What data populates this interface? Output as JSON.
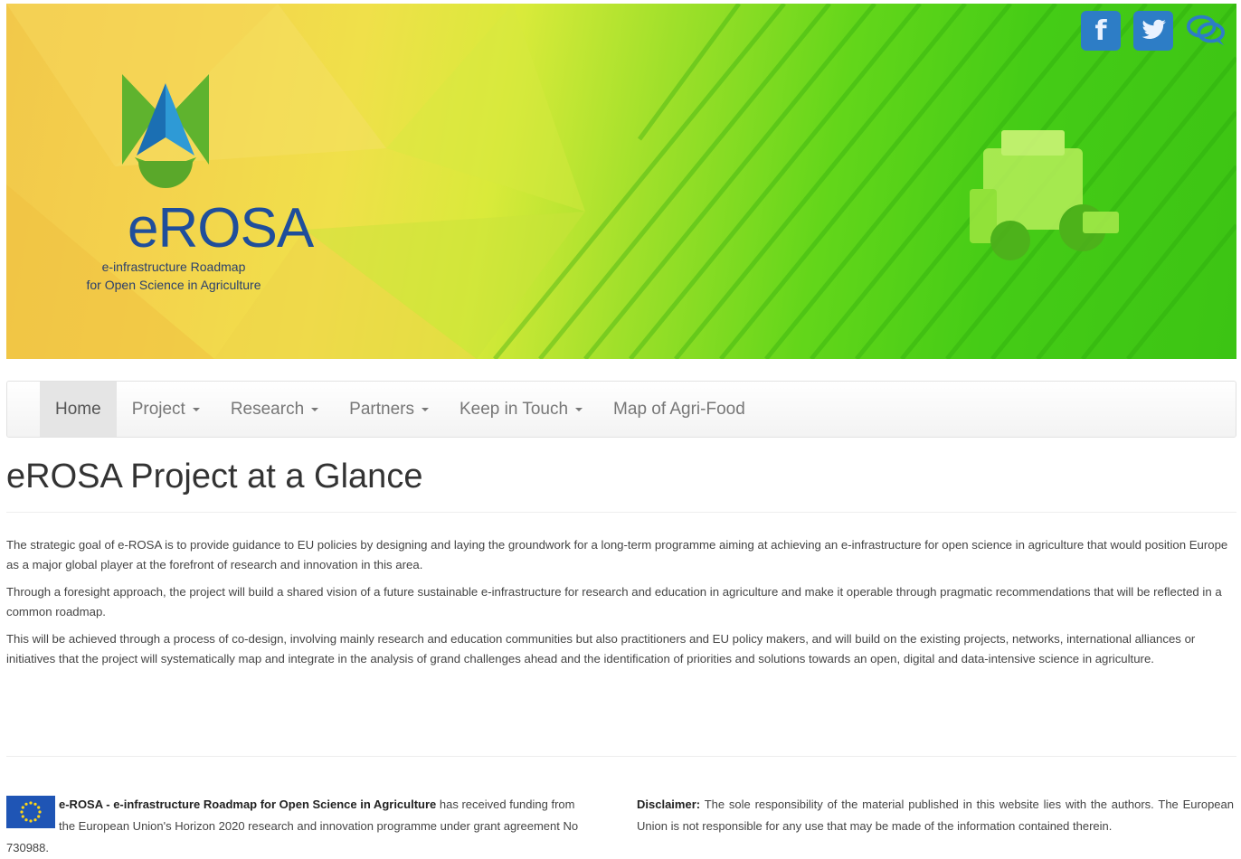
{
  "banner": {
    "logo_title": "eROSA",
    "logo_subtitle_line1": "e-infrastructure Roadmap",
    "logo_subtitle_line2": "for Open Science in Agriculture",
    "social": [
      {
        "icon": "facebook-icon",
        "glyph": "f"
      },
      {
        "icon": "twitter-icon",
        "glyph": "t"
      },
      {
        "icon": "chat-icon",
        "glyph": ""
      }
    ]
  },
  "nav": {
    "items": [
      {
        "label": "Home",
        "active": true,
        "dropdown": false
      },
      {
        "label": "Project",
        "active": false,
        "dropdown": true
      },
      {
        "label": "Research",
        "active": false,
        "dropdown": true
      },
      {
        "label": "Partners",
        "active": false,
        "dropdown": true
      },
      {
        "label": "Keep in Touch",
        "active": false,
        "dropdown": true
      },
      {
        "label": "Map of Agri-Food",
        "active": false,
        "dropdown": false
      }
    ]
  },
  "main": {
    "title": "eROSA Project at a Glance",
    "paragraphs": [
      "The strategic goal of e-ROSA is to provide guidance to EU policies by designing and laying the groundwork for a long-term programme aiming at achieving an e-infrastructure for open science in agriculture that would position Europe as a major global player at the forefront of research and innovation in this area.",
      "Through a foresight approach, the project will build a shared vision of a future sustainable e-infrastructure for research and education in agriculture and make it operable through pragmatic recommendations that will be reflected in a common roadmap.",
      "This will be achieved through a process of co-design, involving mainly research and education communities but also practitioners and EU policy makers, and will build on the existing projects, networks, international alliances or initiatives that the project will systematically map and integrate in the analysis of grand challenges ahead and the identification of priorities and solutions towards an open, digital and data-intensive science in agriculture."
    ]
  },
  "footer": {
    "funding_bold": "e-ROSA -  e-infrastructure Roadmap for Open Science in Agriculture",
    "funding_text": " has received funding from the European Union's Horizon 2020 research and innovation programme under grant agreement No 730988.",
    "disclaimer_label": "Disclaimer:",
    "disclaimer_text": " The sole responsibility of the material published in this website lies with the authors. The European Union is not responsible for any use that may be made of the information contained therein."
  },
  "colors": {
    "logo_blue": "#1f4e9b",
    "social_blue": "#2d7dc6",
    "nav_active_bg": "#e5e5e5",
    "eu_blue": "#1f55b5"
  }
}
